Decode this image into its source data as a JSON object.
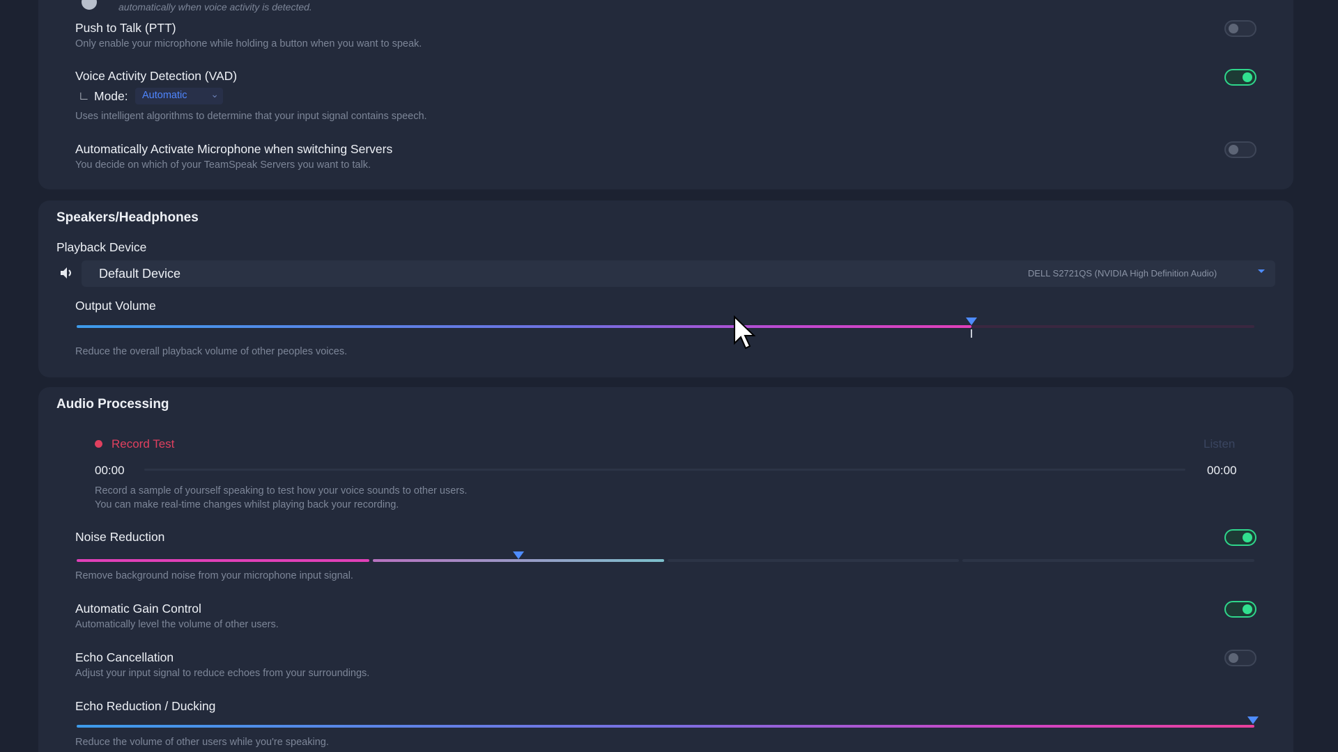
{
  "vad_top": {
    "description_partial": "automatically when voice activity is detected."
  },
  "ptt": {
    "title": "Push to Talk (PTT)",
    "description": "Only enable your microphone while holding a button when you want to speak.",
    "enabled": false
  },
  "vad": {
    "title": "Voice Activity Detection (VAD)",
    "mode_prefix": "∟",
    "mode_label": "Mode:",
    "mode_value": "Automatic",
    "description": "Uses intelligent algorithms to determine that your input signal contains speech.",
    "enabled": true
  },
  "auto_activate": {
    "title": "Automatically Activate Microphone when switching Servers",
    "description": "You decide on which of your TeamSpeak Servers you want to talk.",
    "enabled": false
  },
  "speakers": {
    "section_title": "Speakers/Headphones",
    "playback_label": "Playback Device",
    "device_name": "Default Device",
    "device_detail": "DELL S2721QS (NVIDIA High Definition Audio)",
    "output_volume_label": "Output Volume",
    "output_volume_level": 0.76,
    "output_volume_description": "Reduce the overall playback volume of other peoples voices."
  },
  "audio_processing": {
    "section_title": "Audio Processing",
    "record_test_label": "Record Test",
    "listen_label": "Listen",
    "time_start": "00:00",
    "time_end": "00:00",
    "record_description_1": "Record a sample of yourself speaking to test how your voice sounds to other users.",
    "record_description_2": "You can make real-time changes whilst playing back your recording.",
    "noise_reduction": {
      "title": "Noise Reduction",
      "description": "Remove background noise from your microphone input signal.",
      "enabled": true,
      "level": 0.375
    },
    "agc": {
      "title": "Automatic Gain Control",
      "description": "Automatically level the volume of other users.",
      "enabled": true
    },
    "echo_cancellation": {
      "title": "Echo Cancellation",
      "description": "Adjust your input signal to reduce echoes from your surroundings.",
      "enabled": false
    },
    "echo_reduction": {
      "title": "Echo Reduction / Ducking",
      "description": "Reduce the volume of other users while you're speaking.",
      "level": 1.0
    }
  },
  "colors": {
    "accent_blue": "#4e8cff",
    "toggle_on": "#31e08f",
    "record_red": "#e0405f",
    "slider_pink": "#e040b8"
  }
}
